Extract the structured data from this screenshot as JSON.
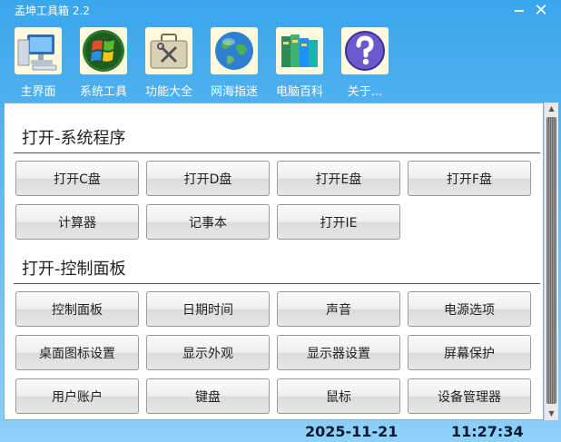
{
  "app": {
    "title": "孟坤工具箱 2.2",
    "minimize_glyph": "−",
    "close_glyph": "✕"
  },
  "toolbar": {
    "items": [
      {
        "label": "主界面",
        "icon": "computer-icon"
      },
      {
        "label": "系统工具",
        "icon": "windows-logo-icon"
      },
      {
        "label": "功能大全",
        "icon": "toolbox-icon"
      },
      {
        "label": "网海指迷",
        "icon": "globe-icon"
      },
      {
        "label": "电脑百科",
        "icon": "books-icon"
      },
      {
        "label": "关于...",
        "icon": "help-icon"
      }
    ]
  },
  "sections": [
    {
      "title": "打开-系统程序",
      "buttons": [
        "打开C盘",
        "打开D盘",
        "打开E盘",
        "打开F盘",
        "计算器",
        "记事本",
        "打开IE"
      ]
    },
    {
      "title": "打开-控制面板",
      "buttons": [
        "控制面板",
        "日期时间",
        "声音",
        "电源选项",
        "桌面图标设置",
        "显示外观",
        "显示器设置",
        "屏幕保护",
        "用户账户",
        "键盘",
        "鼠标",
        "设备管理器"
      ]
    }
  ],
  "status": {
    "date": "2025-11-21",
    "time": "11:27:34"
  },
  "colors": {
    "window_top": "#3aa6ec",
    "window_bottom": "#8ed0f8",
    "panel_border": "#7fb3d8"
  }
}
